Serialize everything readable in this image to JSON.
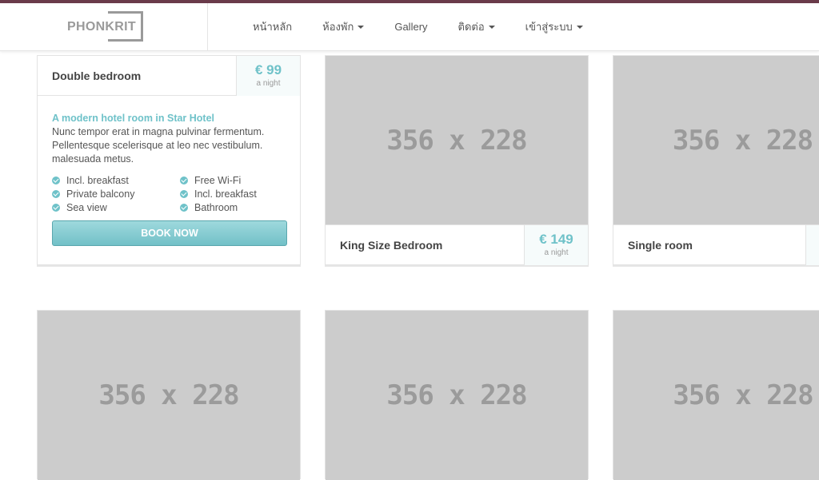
{
  "logo": {
    "text": "PHONKRIT"
  },
  "nav": {
    "items": [
      {
        "label": "หน้าหลัก",
        "dropdown": false
      },
      {
        "label": "ห้องพัก",
        "dropdown": true
      },
      {
        "label": "Gallery",
        "dropdown": false
      },
      {
        "label": "ติดต่อ",
        "dropdown": true
      },
      {
        "label": "เข้าสู่ระบบ",
        "dropdown": true
      }
    ]
  },
  "rooms": {
    "featured": {
      "title": "Double bedroom",
      "price": "€ 99",
      "price_unit": "a night",
      "desc_title": "A modern hotel room in Star Hotel",
      "desc_text": "Nunc tempor erat in magna pulvinar fermentum. Pellentesque scelerisque at leo nec vestibulum. malesuada metus.",
      "features": [
        "Incl. breakfast",
        "Free Wi-Fi",
        "Private balcony",
        "Incl. breakfast",
        "Sea view",
        "Bathroom"
      ],
      "book_label": "Book now"
    },
    "king": {
      "title": "King Size Bedroom",
      "price": "€ 149",
      "price_unit": "a night",
      "image_label": "356 x 228"
    },
    "single": {
      "title": "Single room",
      "image_label": "356 x 228"
    },
    "row2": [
      {
        "image_label": "356 x 228"
      },
      {
        "image_label": "356 x 228"
      },
      {
        "image_label": "356 x 228"
      }
    ]
  },
  "colors": {
    "accent": "#6fc2c9",
    "topline": "#6a3b4a",
    "placeholder": "#cccccc"
  }
}
